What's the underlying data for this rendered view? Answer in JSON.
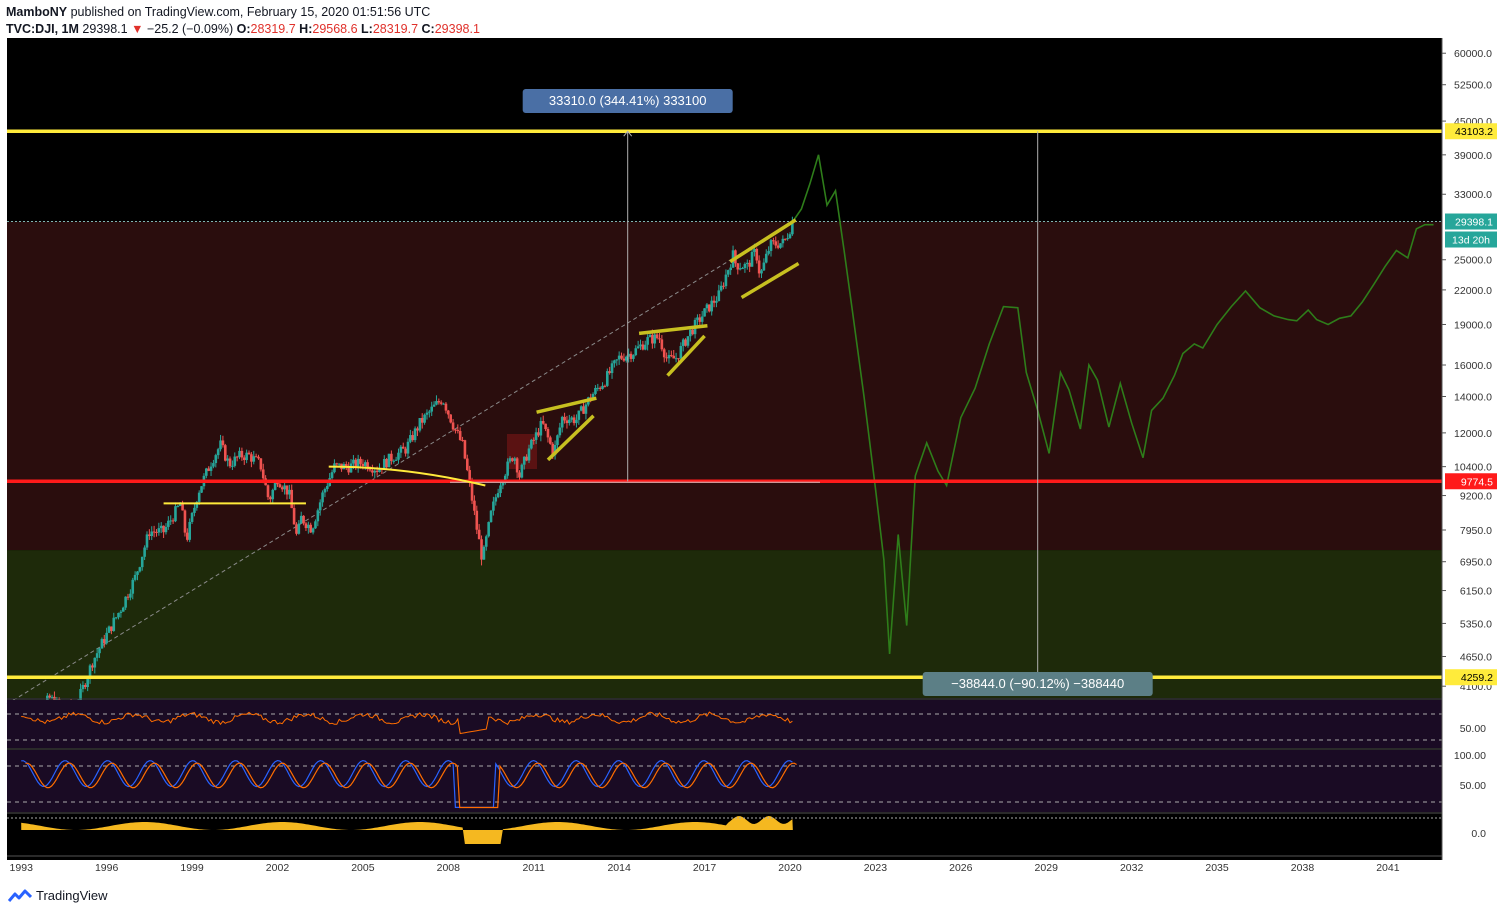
{
  "header": {
    "author": "MamboNY",
    "publish_text": "published on TradingView.com, February 15, 2020 01:51:56 UTC",
    "symbol": "TVC:DJI, 1M",
    "last": "29398.1",
    "change_arrow": "▼",
    "change": "−25.2 (−0.09%)",
    "o_label": "O:",
    "o_value": "28319.7",
    "h_label": "H:",
    "h_value": "29568.6",
    "l_label": "L:",
    "l_value": "28319.7",
    "c_label": "C:",
    "c_value": "29398.1"
  },
  "brand": {
    "name": "TradingView",
    "icon": "tradingview-logo-icon"
  },
  "colors": {
    "background": "#000000",
    "upper_zone": "#2a0d0d",
    "lower_zone": "#1e2a0a",
    "candle_up": "#26a69a",
    "candle_down": "#ef5350",
    "yellow_line": "#ffeb3b",
    "red_line": "#ff1a1a",
    "projection": "#2e7d1a",
    "rsi_line": "#ff6d00",
    "stoch_k": "#2962ff",
    "stoch_d": "#ff6d00",
    "osc_fill": "#f5b820",
    "indicator_bg": "#1a0b24"
  },
  "chart_data": {
    "type": "line",
    "title": "",
    "xlabel": "",
    "ylabel": "",
    "scale": "log",
    "ylim": [
      3900,
      64000
    ],
    "xlim": [
      1992.5,
      2042.9
    ],
    "x_ticks": [
      "1993",
      "1996",
      "1999",
      "2002",
      "2005",
      "2008",
      "2011",
      "2014",
      "2017",
      "2020",
      "2023",
      "2026",
      "2029",
      "2032",
      "2035",
      "2038",
      "2041"
    ],
    "y_ticks": [
      "60000.0",
      "52500.0",
      "45000.0",
      "39000.0",
      "33000.0",
      "25000.0",
      "22000.0",
      "19000.0",
      "16000.0",
      "14000.0",
      "12000.0",
      "10400.0",
      "9200.0",
      "7950.0",
      "6950.0",
      "6150.0",
      "5350.0",
      "4650.0",
      "4100.0"
    ],
    "price_labels": [
      {
        "value": 43103.2,
        "text": "43103.2",
        "kind": "yellow"
      },
      {
        "value": 29398.1,
        "text": "29398.1",
        "kind": "last"
      },
      {
        "value": 9774.5,
        "text": "9774.5",
        "kind": "red"
      },
      {
        "value": 4259.2,
        "text": "4259.2",
        "kind": "yellow"
      }
    ],
    "countdown": "13d 20h",
    "horizontal_lines": [
      {
        "value": 43103.2,
        "color": "yellow"
      },
      {
        "value": 9774.5,
        "color": "red"
      },
      {
        "value": 4259.2,
        "color": "yellow"
      }
    ],
    "measure_up": {
      "text": "33310.0 (344.41%) 333100",
      "x": 2014.3,
      "from": 9774.5,
      "to": 43103.2
    },
    "measure_down": {
      "text": "−38844.0 (−90.12%) −388440",
      "x": 2028.7,
      "from": 43103.2,
      "to": 4259.2
    },
    "historical": {
      "name": "DJI",
      "x": [
        1993.0,
        1994.0,
        1994.5,
        1995.0,
        1995.5,
        1996.0,
        1996.5,
        1997.0,
        1997.5,
        1998.0,
        1998.6,
        1998.8,
        1999.2,
        1999.7,
        2000.0,
        2000.3,
        2000.7,
        2001.0,
        2001.4,
        2001.7,
        2002.0,
        2002.4,
        2002.7,
        2002.8,
        2003.2,
        2003.6,
        2004.0,
        2004.5,
        2005.0,
        2005.5,
        2006.0,
        2006.5,
        2007.0,
        2007.5,
        2007.8,
        2008.2,
        2008.5,
        2008.8,
        2009.0,
        2009.2,
        2009.5,
        2009.8,
        2010.3,
        2010.5,
        2010.8,
        2011.3,
        2011.7,
        2012.0,
        2012.5,
        2013.0,
        2013.5,
        2014.0,
        2014.5,
        2015.0,
        2015.4,
        2015.7,
        2016.0,
        2016.5,
        2017.0,
        2017.5,
        2018.0,
        2018.1,
        2018.5,
        2018.8,
        2018.95,
        2019.3,
        2019.6,
        2019.8,
        2020.1
      ],
      "close": [
        3300,
        3900,
        3700,
        3850,
        4550,
        5100,
        5700,
        6500,
        7900,
        7900,
        8900,
        7600,
        9300,
        10700,
        11400,
        10500,
        10900,
        10900,
        10500,
        9000,
        9900,
        9300,
        7600,
        8400,
        8000,
        9300,
        10400,
        10400,
        10600,
        10300,
        10800,
        11200,
        12500,
        13400,
        13900,
        12300,
        11400,
        9300,
        8000,
        7000,
        8500,
        9700,
        11000,
        10000,
        11100,
        12500,
        11000,
        12800,
        12700,
        14000,
        15000,
        16500,
        16900,
        17800,
        18000,
        16300,
        16500,
        18400,
        20000,
        21500,
        25500,
        24500,
        24300,
        26000,
        23300,
        26600,
        26800,
        26900,
        29400
      ]
    },
    "projection": {
      "name": "",
      "x": [
        2020.1,
        2020.4,
        2020.7,
        2021.0,
        2021.3,
        2021.6,
        2021.9,
        2022.2,
        2022.6,
        2023.0,
        2023.3,
        2023.5,
        2023.8,
        2024.1,
        2024.4,
        2024.8,
        2025.2,
        2025.5,
        2026.0,
        2026.5,
        2027.0,
        2027.5,
        2028.0,
        2028.3,
        2028.7,
        2029.1,
        2029.5,
        2029.8,
        2030.2,
        2030.5,
        2030.8,
        2031.2,
        2031.6,
        2032.0,
        2032.4,
        2032.7,
        2033.1,
        2033.5,
        2033.8,
        2034.2,
        2034.5,
        2035.0,
        2035.5,
        2036.0,
        2036.5,
        2037.0,
        2037.5,
        2037.8,
        2038.2,
        2038.5,
        2038.9,
        2039.3,
        2039.7,
        2040.1,
        2040.5,
        2040.9,
        2041.3,
        2041.7,
        2042.0,
        2042.3,
        2042.6
      ],
      "close": [
        29400,
        31000,
        34500,
        39000,
        31500,
        33500,
        26000,
        20000,
        14000,
        9500,
        7000,
        4700,
        7800,
        5300,
        10000,
        11500,
        10200,
        9600,
        12800,
        14500,
        17500,
        20500,
        20400,
        15500,
        13200,
        11000,
        15500,
        14400,
        12200,
        16000,
        15000,
        12300,
        14800,
        12500,
        10800,
        13200,
        13900,
        15300,
        16800,
        17500,
        17200,
        19000,
        20500,
        21900,
        20400,
        19700,
        19400,
        19300,
        20200,
        19400,
        19000,
        19500,
        19700,
        20900,
        22500,
        24300,
        26000,
        25200,
        28500,
        29000,
        29000
      ]
    },
    "annotations": [
      {
        "type": "arc",
        "from": [
          1998.0,
          8900
        ],
        "to": [
          2003.0,
          8900
        ],
        "peak": 13200
      },
      {
        "type": "arc",
        "from": [
          2003.8,
          10400
        ],
        "to": [
          2009.3,
          9600
        ],
        "peak": 15300
      },
      {
        "type": "dashed-trend",
        "from": [
          1992.5,
          3800
        ],
        "to": [
          2020.2,
          29600
        ]
      },
      {
        "type": "wedge",
        "from": [
          2011.1,
          13100
        ],
        "to": [
          2013.2,
          13900
        ]
      },
      {
        "type": "wedge",
        "from": [
          2011.5,
          10700
        ],
        "to": [
          2013.1,
          12900
        ]
      },
      {
        "type": "wedge",
        "from": [
          2014.7,
          18300
        ],
        "to": [
          2017.1,
          18900
        ]
      },
      {
        "type": "wedge",
        "from": [
          2015.7,
          15300
        ],
        "to": [
          2017.0,
          18100
        ]
      },
      {
        "type": "wedge",
        "from": [
          2017.9,
          24800
        ],
        "to": [
          2020.2,
          29600
        ]
      },
      {
        "type": "wedge",
        "from": [
          2018.3,
          21300
        ],
        "to": [
          2020.3,
          24600
        ]
      }
    ],
    "rsi": {
      "y_ticks": [
        "50.00"
      ]
    },
    "stoch_rsi": {
      "y_ticks": [
        "100.00",
        "50.00"
      ]
    },
    "oscillator": {
      "y_ticks": [
        "0.0"
      ]
    }
  }
}
